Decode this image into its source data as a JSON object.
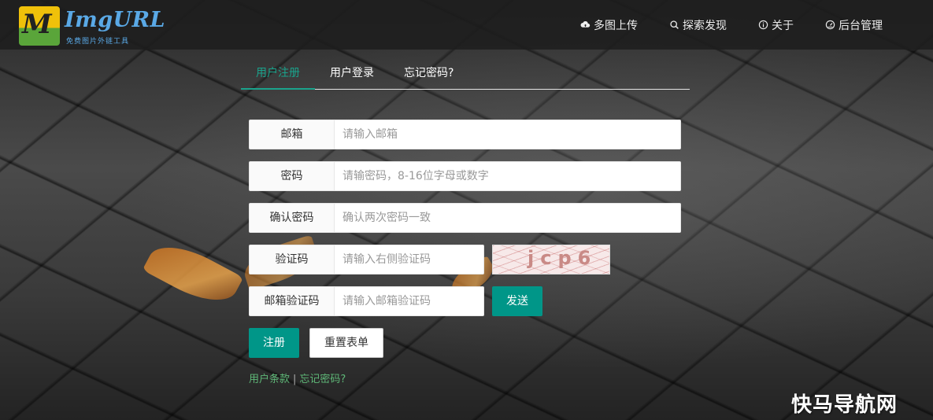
{
  "brand": {
    "name": "ImgURL",
    "tagline": "免费图片外链工具"
  },
  "nav": {
    "items": [
      {
        "label": "多图上传",
        "icon": "cloud-upload-icon"
      },
      {
        "label": "探索发现",
        "icon": "search-icon"
      },
      {
        "label": "关于",
        "icon": "info-icon"
      },
      {
        "label": "后台管理",
        "icon": "dashboard-icon"
      }
    ]
  },
  "tabs": [
    {
      "label": "用户注册",
      "active": true
    },
    {
      "label": "用户登录",
      "active": false
    },
    {
      "label": "忘记密码?",
      "active": false
    }
  ],
  "form": {
    "email": {
      "label": "邮箱",
      "value": "",
      "placeholder": "请输入邮箱"
    },
    "password": {
      "label": "密码",
      "value": "",
      "placeholder": "请输密码，8-16位字母或数字"
    },
    "confirm": {
      "label": "确认密码",
      "value": "",
      "placeholder": "确认两次密码一致"
    },
    "captcha": {
      "label": "验证码",
      "value": "",
      "placeholder": "请输入右侧验证码",
      "image_text": "jcp6"
    },
    "email_code": {
      "label": "邮箱验证码",
      "value": "",
      "placeholder": "请输入邮箱验证码"
    },
    "send_button": "发送",
    "submit_button": "注册",
    "reset_button": "重置表单"
  },
  "footer_links": {
    "terms": "用户条款",
    "separator": "|",
    "forgot": "忘记密码?"
  },
  "watermark": "快马导航网",
  "colors": {
    "accent": "#009688",
    "tab_active": "#1aa38c",
    "link": "#5fb878",
    "navbar_bg": "#1e1e1e"
  }
}
